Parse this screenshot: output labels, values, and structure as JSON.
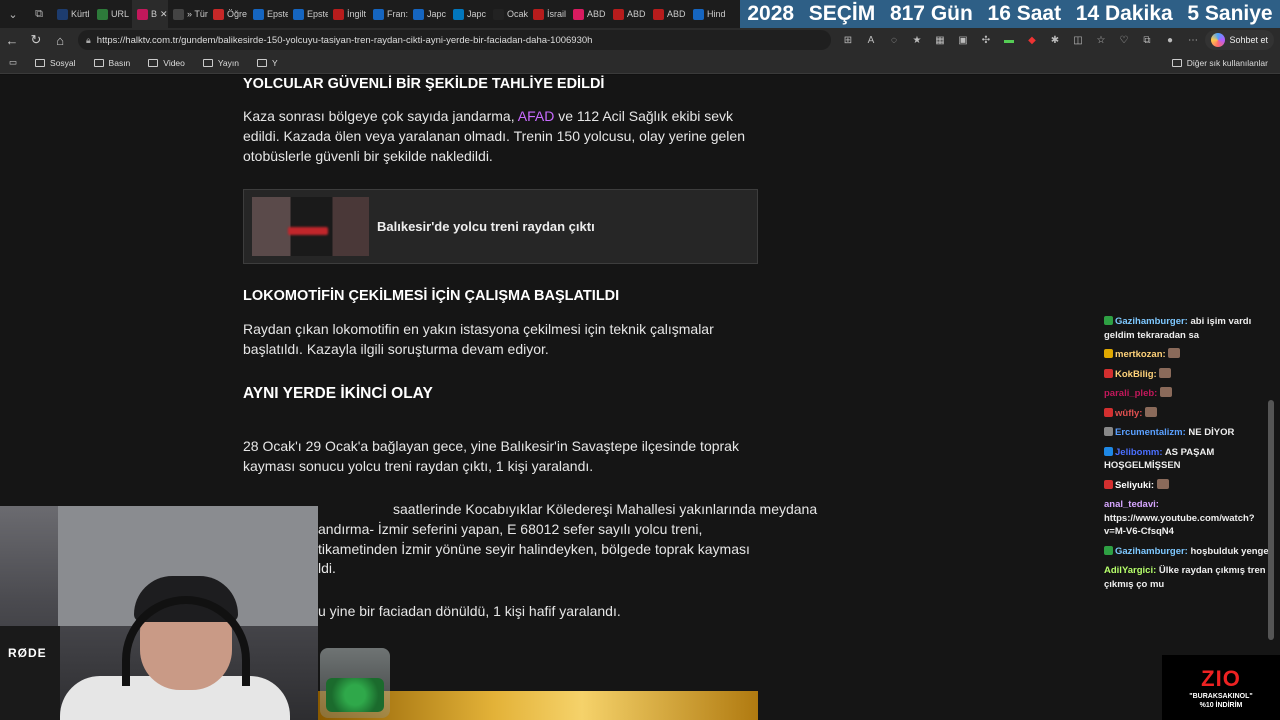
{
  "tabs": [
    {
      "label": "Kürtl",
      "color": "#1d3c6e"
    },
    {
      "label": "URL",
      "color": "#2d7a3a"
    },
    {
      "label": "B",
      "color": "#c2185b",
      "active": true
    },
    {
      "label": "» Tür",
      "color": "#444"
    },
    {
      "label": "Öğre",
      "color": "#c62828"
    },
    {
      "label": "Epste",
      "color": "#1565c0"
    },
    {
      "label": "Epste",
      "color": "#1565c0"
    },
    {
      "label": "İngilt",
      "color": "#b71c1c"
    },
    {
      "label": "Fran:",
      "color": "#1565c0"
    },
    {
      "label": "Japc",
      "color": "#1565c0"
    },
    {
      "label": "Japc",
      "color": "#0277bd"
    },
    {
      "label": "Ocak",
      "color": "#222"
    },
    {
      "label": "İsrail",
      "color": "#b71c1c"
    },
    {
      "label": "ABD",
      "color": "#d81b60"
    },
    {
      "label": "ABD",
      "color": "#b71c1c"
    },
    {
      "label": "ABD",
      "color": "#b71c1c"
    },
    {
      "label": "Hind",
      "color": "#1565c0"
    }
  ],
  "countdown": {
    "year": "2028",
    "label": "SEÇİM",
    "days": "817 Gün",
    "hours": "16 Saat",
    "minutes": "14 Dakika",
    "seconds": "5 Saniye"
  },
  "addressbar": {
    "url": "https://halktv.com.tr/gundem/balikesirde-150-yolcuyu-tasiyan-tren-raydan-cikti-ayni-yerde-bir-faciadan-daha-1006930h",
    "chat_button": "Sohbet et"
  },
  "bookmarks": {
    "items": [
      "Sosyal",
      "Basın",
      "Video",
      "Yayın",
      "Y"
    ],
    "other": "Diğer sık kullanılanlar"
  },
  "article": {
    "heading1": "YOLCULAR GÜVENLİ BİR ŞEKİLDE TAHLİYE EDİLDİ",
    "p1_before": "Kaza sonrası bölgeye çok sayıda jandarma,",
    "p1_link": "AFAD",
    "p1_after": "ve 112 Acil Sağlık ekibi sevk edildi. Kazada ölen veya yaralanan olmadı. Trenin 150 yolcusu, olay yerine gelen otobüslerle güvenli bir şekilde nakledildi.",
    "related_title": "Balıkesir'de yolcu treni raydan çıktı",
    "heading2": "LOKOMOTİFİN ÇEKİLMESİ İÇİN ÇALIŞMA BAŞLATILDI",
    "p2": "Raydan çıkan lokomotifin en yakın istasyona çekilmesi için teknik çalışmalar başlatıldı. Kazayla ilgili soruşturma devam ediyor.",
    "heading3": "AYNI YERDE İKİNCİ OLAY",
    "p3": "28 Ocak'ı 29 Ocak'a bağlayan gece, yine Balıkesir'in Savaştepe ilçesinde toprak kayması sonucu yolcu treni raydan çıktı, 1 kişi yaralandı.",
    "p4_line1": "saatlerinde Kocabıyıklar Köledereşi Mahallesi yakınlarında meydana",
    "p4_line2": "andırma- İzmir seferini yapan, E 68012 sefer sayılı yolcu treni,",
    "p4_line3": "tikametinden İzmir yönüne seyir halindeyken, bölgede toprak kayması",
    "p4_line4": "ldi.",
    "p5": "u yine bir faciadan dönüldü, 1 kişi hafif yaralandı."
  },
  "chat": [
    {
      "user": "Gazihamburger:",
      "text": "abi işim vardı geldim tekraradan sa",
      "color": "#7ec8ff",
      "badge": "#2ea043"
    },
    {
      "user": "mertkozan:",
      "text": "",
      "color": "#ffd27a",
      "badge": "#e0a800"
    },
    {
      "user": "KokBilig:",
      "text": "",
      "color": "#ffd27a",
      "badge": "#d32f2f"
    },
    {
      "user": "parali_pleb:",
      "text": "",
      "color": "#c2185b",
      "badge": ""
    },
    {
      "user": "wûfly:",
      "text": "",
      "color": "#e05050",
      "badge": "#d32f2f"
    },
    {
      "user": "Ercumentalizm:",
      "text": "NE DİYOR",
      "color": "#5aa0ff",
      "badge": "#888"
    },
    {
      "user": "Jelibomm:",
      "text": "AS PAŞAM HOŞGELMİŞSEN",
      "color": "#4a6fff",
      "badge": "#1e88e5"
    },
    {
      "user": "Seliyuki:",
      "text": "",
      "color": "#ffffff",
      "badge": "#d32f2f"
    },
    {
      "user": "anal_tedavi:",
      "text": "https://www.youtube.com/watch?v=M-V6-CfsqN4",
      "color": "#d6a6ff",
      "badge": ""
    },
    {
      "user": "Gazihamburger:",
      "text": "hoşbulduk yenge",
      "color": "#7ec8ff",
      "badge": "#2ea043"
    },
    {
      "user": "AdilYargici:",
      "text": "Ülke raydan çıkmış tren çıkmış ço mu",
      "color": "#b6ff6b",
      "badge": ""
    }
  ],
  "webcam": {
    "brand": "RØDE"
  },
  "promo": {
    "logo": "ZIO",
    "code": "\"BURAKSAKINOL\"",
    "discount": "%10 İNDİRİM"
  }
}
